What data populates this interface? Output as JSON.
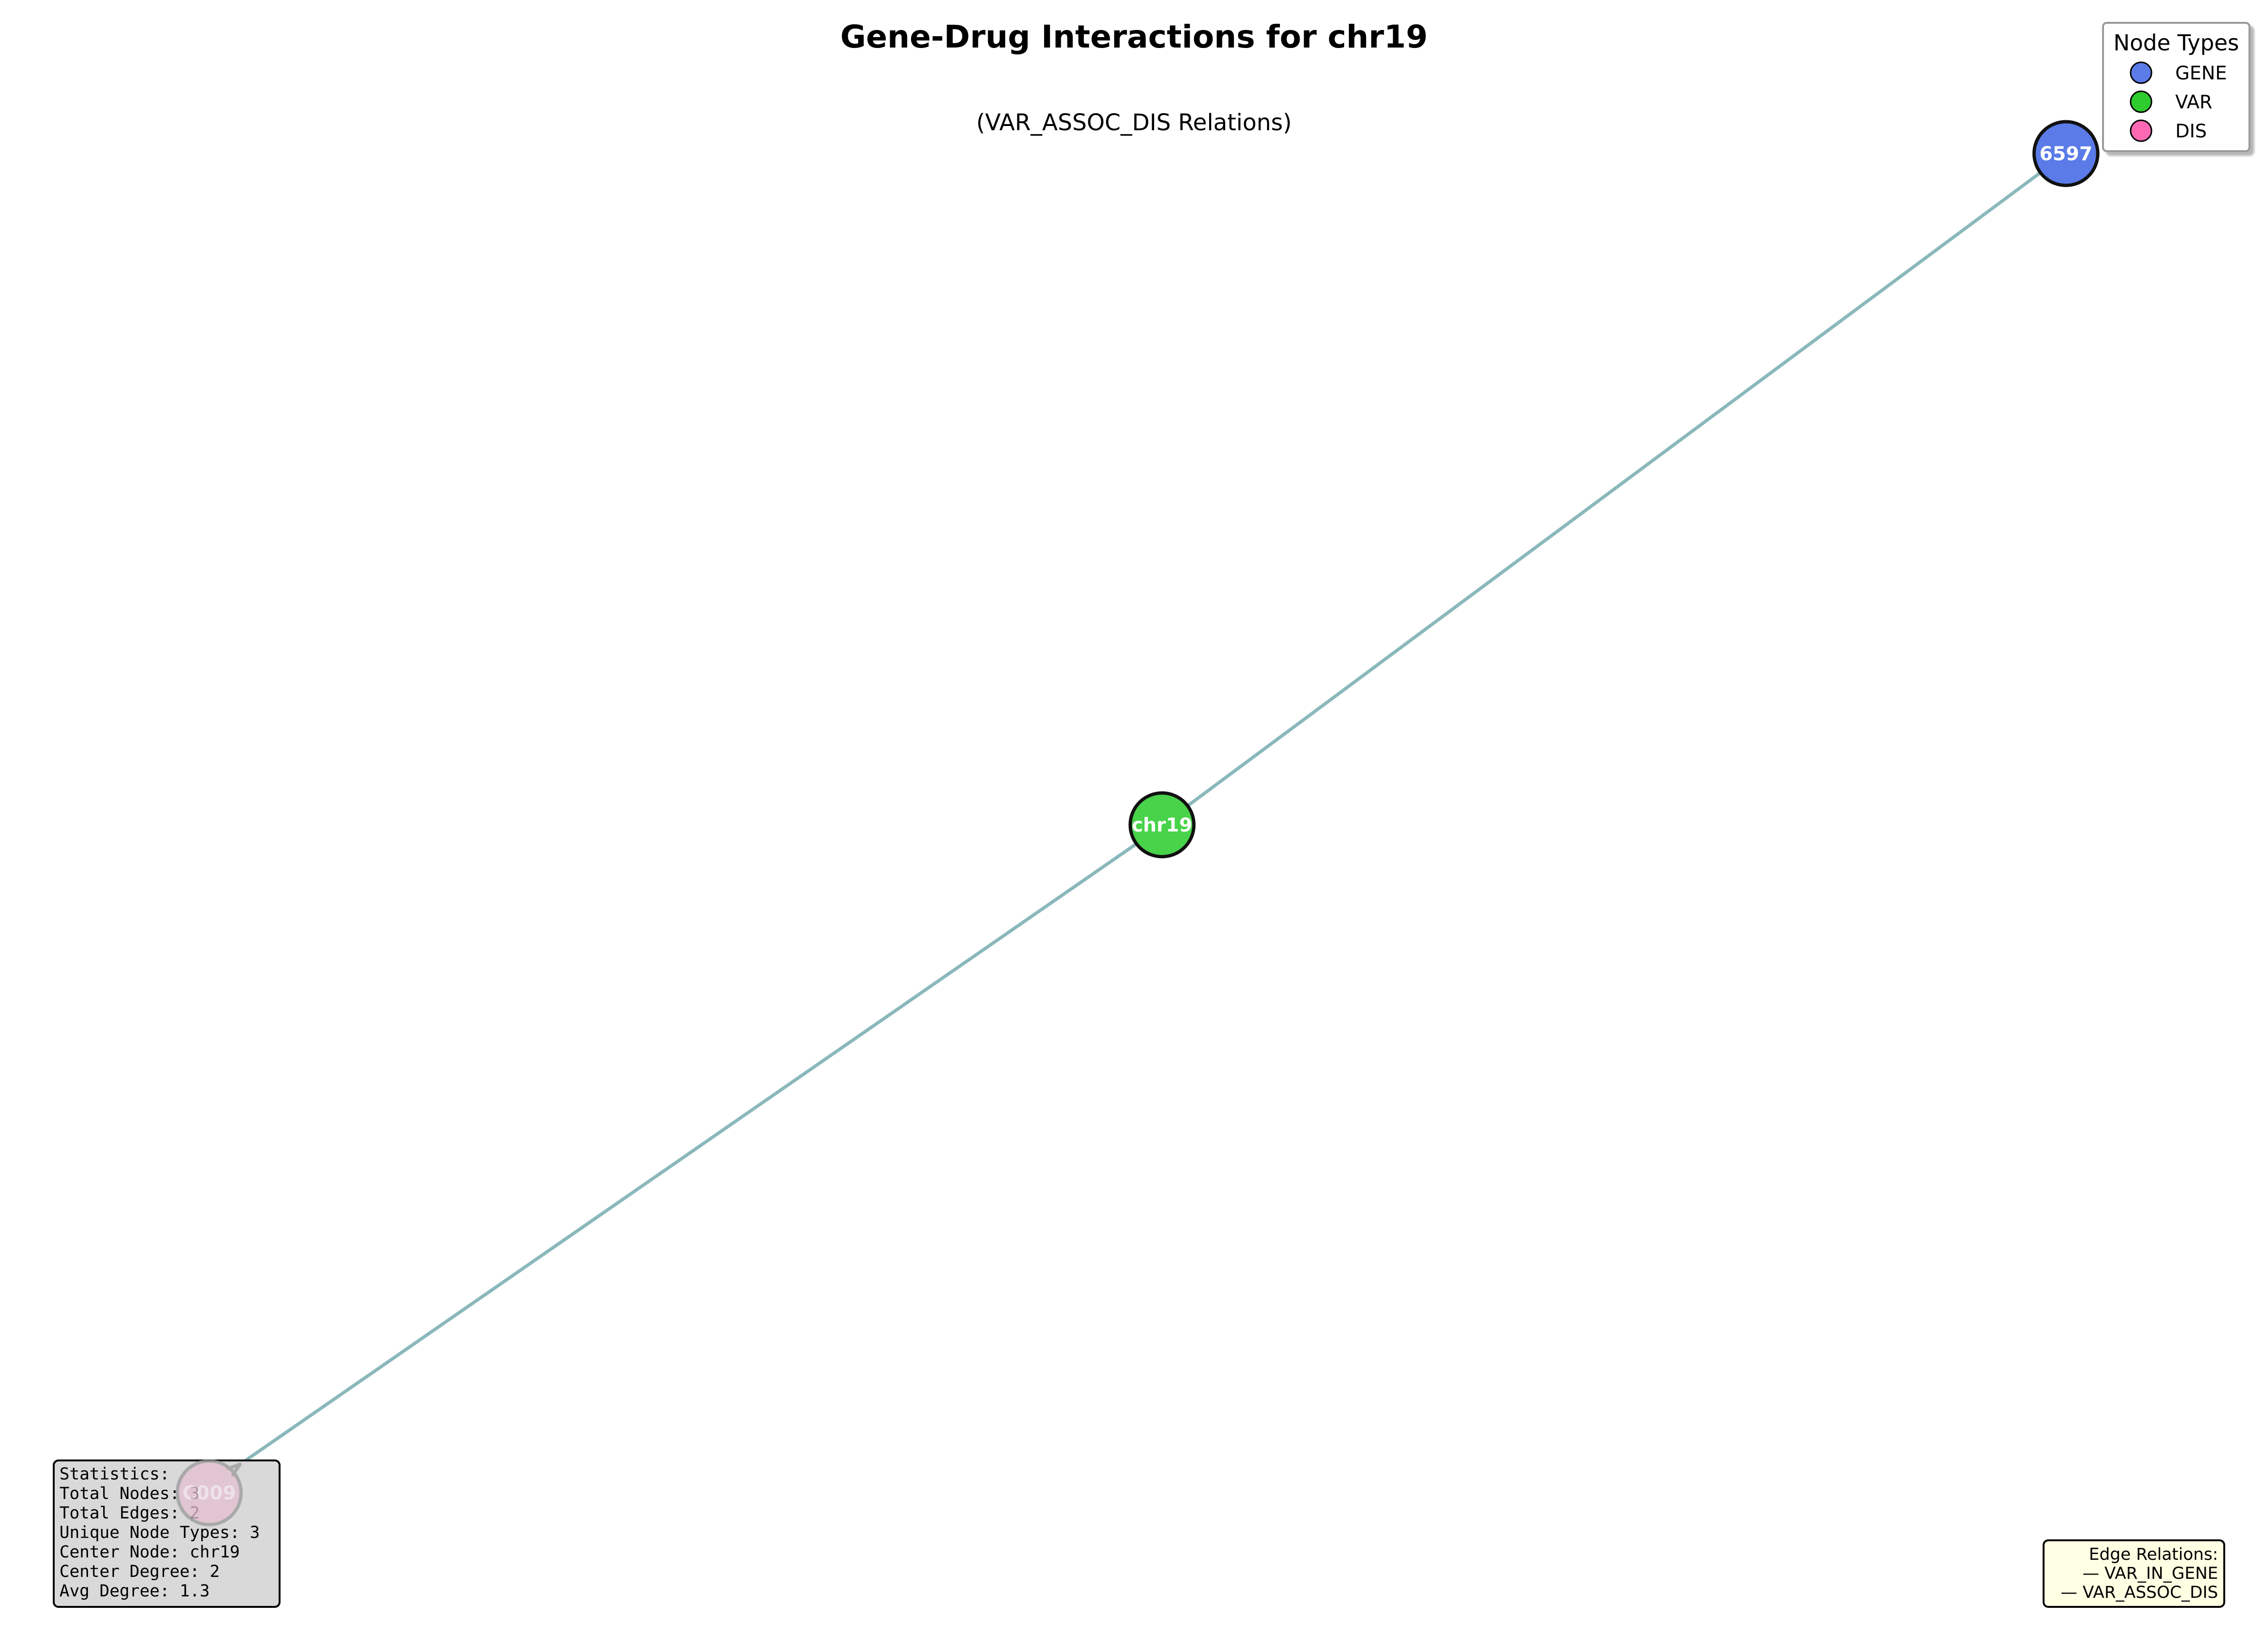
{
  "title": "Gene-Drug Interactions for chr19",
  "subtitle": "(VAR_ASSOC_DIS Relations)",
  "colors": {
    "GENE": "#5a7be8",
    "VAR": "#48d34a",
    "DIS": "#e6bfd0",
    "edge": "#8ab8bb",
    "node_border": "#111111",
    "stats_bg": "#d9d9d9",
    "relations_bg": "#ffffe3"
  },
  "nodes": [
    {
      "id": "gene",
      "label": "6597",
      "type": "GENE"
    },
    {
      "id": "var",
      "label": "chr19",
      "type": "VAR"
    },
    {
      "id": "dis",
      "label": "C009",
      "type": "DIS"
    }
  ],
  "edges": [
    {
      "source": "var",
      "target": "gene",
      "relation": "VAR_IN_GENE"
    },
    {
      "source": "var",
      "target": "dis",
      "relation": "VAR_ASSOC_DIS"
    }
  ],
  "legend": {
    "title": "Node Types",
    "items": [
      {
        "label": "GENE",
        "color": "#5a7be8"
      },
      {
        "label": "VAR",
        "color": "#2ecc2e"
      },
      {
        "label": "DIS",
        "color": "#ff69b4"
      }
    ]
  },
  "stats": {
    "heading": "Statistics:",
    "total_nodes": "Total Nodes: 3",
    "total_edges": "Total Edges: 2",
    "unique_types": "Unique Node Types: 3",
    "center_node": "Center Node: chr19",
    "center_degree": "Center Degree: 2",
    "avg_degree": "Avg Degree: 1.3"
  },
  "relations": {
    "heading": "Edge Relations:",
    "items": [
      "— VAR_IN_GENE",
      "— VAR_ASSOC_DIS"
    ]
  }
}
